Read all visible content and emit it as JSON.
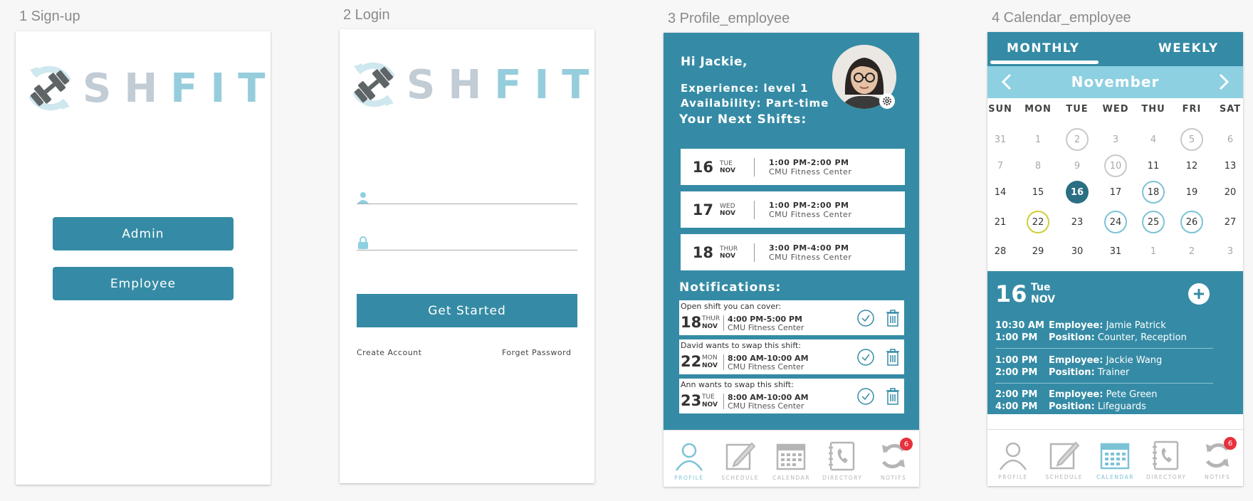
{
  "artboards": {
    "signup": "1 Sign-up",
    "login": "2 Login",
    "profile": "3 Profile_employee",
    "calendar": "4 Calendar_employee"
  },
  "brand": {
    "name_part1": "SH",
    "name_part2": "FIT",
    "icon": "dumbbell-refresh-logo-icon",
    "colors": {
      "primary": "#358ba5",
      "light": "#8dd0e1",
      "logo_grey": "#c1ccd5",
      "logo_teal": "#96cddc"
    }
  },
  "signup": {
    "admin_label": "Admin",
    "employee_label": "Employee"
  },
  "login": {
    "username_placeholder": "",
    "password_placeholder": "",
    "username_icon": "user-icon",
    "password_icon": "lock-icon",
    "get_started_label": "Get Started",
    "create_account_label": "Create Account",
    "forget_password_label": "Forget Password"
  },
  "profile": {
    "greeting": "Hi Jackie,",
    "experience": "Experience: level 1",
    "availability": "Availability: Part-time",
    "next_shifts_title": "Your Next Shifts:",
    "shifts": [
      {
        "day": "16",
        "weekday": "TUE",
        "month": "NOV",
        "time": "1:00 PM-2:00 PM",
        "location": "CMU Fitness Center"
      },
      {
        "day": "17",
        "weekday": "WED",
        "month": "NOV",
        "time": "1:00 PM-2:00 PM",
        "location": "CMU Fitness Center"
      },
      {
        "day": "18",
        "weekday": "THUR",
        "month": "NOV",
        "time": "3:00 PM-4:00 PM",
        "location": "CMU Fitness Center"
      }
    ],
    "notifications_title": "Notifications:",
    "notifications": [
      {
        "text": "Open shift you can cover:",
        "day": "18",
        "weekday": "THUR",
        "month": "NOV",
        "time": "4:00 PM-5:00 PM",
        "location": "CMU Fitness Center"
      },
      {
        "text": "David wants to swap this shift:",
        "day": "22",
        "weekday": "MON",
        "month": "NOV",
        "time": "8:00 AM-10:00 AM",
        "location": "CMU Fitness Center"
      },
      {
        "text": "Ann wants to swap this shift:",
        "day": "23",
        "weekday": "TUE",
        "month": "NOV",
        "time": "8:00 AM-10:00 AM",
        "location": "CMU Fitness Center"
      }
    ]
  },
  "tabbar": {
    "profile": "PROFILE",
    "schedule": "SCHEDULE",
    "calendar": "CALENDAR",
    "directory": "DIRECTORY",
    "notifs": "NOTIFS",
    "notif_count": "6"
  },
  "calendar": {
    "tab_monthly": "MONTHLY",
    "tab_weekly": "WEEKLY",
    "month": "November",
    "weekdays": [
      "SUN",
      "MON",
      "TUE",
      "WED",
      "THU",
      "FRI",
      "SAT"
    ],
    "weeks": [
      [
        "31",
        "1",
        "2",
        "3",
        "4",
        "5",
        "6"
      ],
      [
        "7",
        "8",
        "9",
        "10",
        "11",
        "12",
        "13"
      ],
      [
        "14",
        "15",
        "16",
        "17",
        "18",
        "19",
        "20"
      ],
      [
        "21",
        "22",
        "23",
        "24",
        "25",
        "26",
        "27"
      ],
      [
        "28",
        "29",
        "30",
        "31",
        "1",
        "2",
        "3"
      ]
    ],
    "selected_day": "16",
    "selected_weekday": "Tue",
    "selected_month": "NOV",
    "events": [
      {
        "start": "10:30 AM",
        "end": "1:00 PM",
        "employee_label": "Employee:",
        "employee": "Jamie Patrick",
        "position_label": "Position:",
        "position": "Counter, Reception"
      },
      {
        "start": "1:00 PM",
        "end": "2:00 PM",
        "employee_label": "Employee:",
        "employee": "Jackie Wang",
        "position_label": "Position:",
        "position": "Trainer"
      },
      {
        "start": "2:00 PM",
        "end": "4:00 PM",
        "employee_label": "Employee:",
        "employee": "Pete Green",
        "position_label": "Position:",
        "position": "Lifeguards"
      }
    ]
  }
}
